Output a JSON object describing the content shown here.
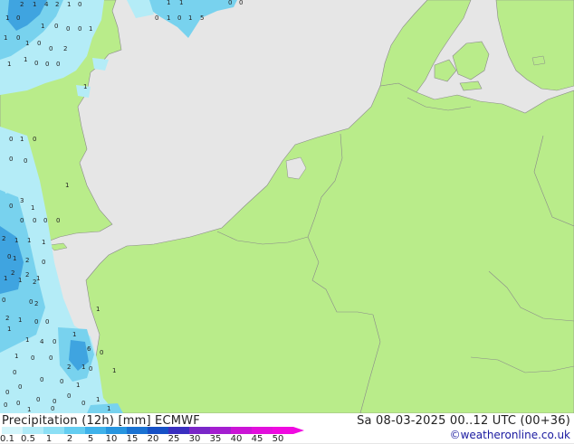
{
  "title": "Precipitation (12h) [mm] ECMWF",
  "timestamp": "Sa 08-03-2025 00..12 UTC (00+36)",
  "credit": "©weatheronline.co.uk",
  "colors": {
    "sea": "#e6e6e6",
    "land": "#b9ec8a",
    "border": "#8a8a8a",
    "precip_light": "#b4ecf7",
    "precip_medium": "#78d2ee",
    "precip_heavy": "#3fa4e0"
  },
  "legend": {
    "labels": [
      "0.1",
      "0.5",
      "1",
      "2",
      "5",
      "10",
      "15",
      "20",
      "25",
      "30",
      "35",
      "40",
      "45",
      "50"
    ],
    "colors": [
      "#d3f5fb",
      "#b0ebf8",
      "#8cdff5",
      "#64cdf1",
      "#3fb2ea",
      "#2795df",
      "#1a72d2",
      "#1650c6",
      "#3a2fc0",
      "#7a27c8",
      "#a41ed0",
      "#cb14d6",
      "#e20fdc",
      "#f00ae0"
    ]
  },
  "map_values": [
    {
      "v": "2"
    },
    {
      "v": "1"
    },
    {
      "v": "4"
    },
    {
      "v": "2"
    },
    {
      "v": "1"
    },
    {
      "v": "0"
    },
    {
      "v": "1"
    },
    {
      "v": "1"
    },
    {
      "v": "0"
    },
    {
      "v": "0"
    },
    {
      "v": "0"
    },
    {
      "v": "1"
    },
    {
      "v": "0"
    },
    {
      "v": "1"
    },
    {
      "v": "5"
    },
    {
      "v": "1"
    },
    {
      "v": "0"
    },
    {
      "v": "1"
    },
    {
      "v": "0"
    },
    {
      "v": "0"
    },
    {
      "v": "0"
    },
    {
      "v": "1"
    },
    {
      "v": "1"
    },
    {
      "v": "0"
    },
    {
      "v": "1"
    },
    {
      "v": "0"
    },
    {
      "v": "0"
    },
    {
      "v": "2"
    },
    {
      "v": "1"
    },
    {
      "v": "1"
    },
    {
      "v": "0"
    },
    {
      "v": "0"
    },
    {
      "v": "0"
    },
    {
      "v": "1"
    },
    {
      "v": "0"
    },
    {
      "v": "1"
    },
    {
      "v": "0"
    },
    {
      "v": "0"
    },
    {
      "v": "0"
    },
    {
      "v": "1"
    },
    {
      "v": "3"
    },
    {
      "v": "0"
    },
    {
      "v": "1"
    },
    {
      "v": "0"
    },
    {
      "v": "0"
    },
    {
      "v": "0"
    },
    {
      "v": "0"
    },
    {
      "v": "2"
    },
    {
      "v": "1"
    },
    {
      "v": "1"
    },
    {
      "v": "1"
    },
    {
      "v": "0"
    },
    {
      "v": "1"
    },
    {
      "v": "2"
    },
    {
      "v": "0"
    },
    {
      "v": "2"
    },
    {
      "v": "2"
    },
    {
      "v": "1"
    },
    {
      "v": "1"
    },
    {
      "v": "1"
    },
    {
      "v": "2"
    },
    {
      "v": "0"
    },
    {
      "v": "0"
    },
    {
      "v": "2"
    },
    {
      "v": "2"
    },
    {
      "v": "1"
    },
    {
      "v": "0"
    },
    {
      "v": "0"
    },
    {
      "v": "1"
    },
    {
      "v": "1"
    },
    {
      "v": "1"
    },
    {
      "v": "4"
    },
    {
      "v": "0"
    },
    {
      "v": "1"
    },
    {
      "v": "1"
    },
    {
      "v": "0"
    },
    {
      "v": "0"
    },
    {
      "v": "6"
    },
    {
      "v": "0"
    },
    {
      "v": "2"
    },
    {
      "v": "1"
    },
    {
      "v": "0"
    },
    {
      "v": "0"
    },
    {
      "v": "1"
    },
    {
      "v": "0"
    },
    {
      "v": "0"
    },
    {
      "v": "1"
    },
    {
      "v": "0"
    },
    {
      "v": "0"
    },
    {
      "v": "0"
    },
    {
      "v": "0"
    },
    {
      "v": "1"
    },
    {
      "v": "0"
    },
    {
      "v": "0"
    },
    {
      "v": "0"
    },
    {
      "v": "0"
    },
    {
      "v": "1"
    },
    {
      "v": "0"
    },
    {
      "v": "1"
    }
  ]
}
